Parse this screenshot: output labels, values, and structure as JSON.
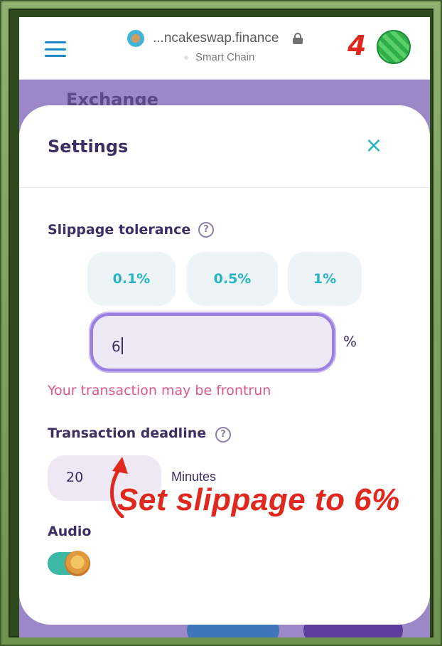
{
  "browser": {
    "url": "...ncakeswap.finance",
    "network": "Smart Chain"
  },
  "annotation": {
    "step_number": "4",
    "callout": "Set slippage to 6%"
  },
  "page": {
    "heading": "Exchange"
  },
  "settings": {
    "title": "Settings",
    "close_icon": "×",
    "slippage": {
      "label": "Slippage tolerance",
      "help": "?",
      "presets": [
        "0.1%",
        "0.5%",
        "1%"
      ],
      "value": "6",
      "unit": "%",
      "warning": "Your transaction may be frontrun"
    },
    "deadline": {
      "label": "Transaction deadline",
      "help": "?",
      "value": "20",
      "unit": "Minutes"
    },
    "audio": {
      "label": "Audio",
      "enabled": true
    }
  },
  "colors": {
    "accent": "#27b4c2",
    "title": "#3d2f63",
    "warning": "#e0568b",
    "annotation": "#e0281e",
    "input_border": "#9b7fe0"
  }
}
